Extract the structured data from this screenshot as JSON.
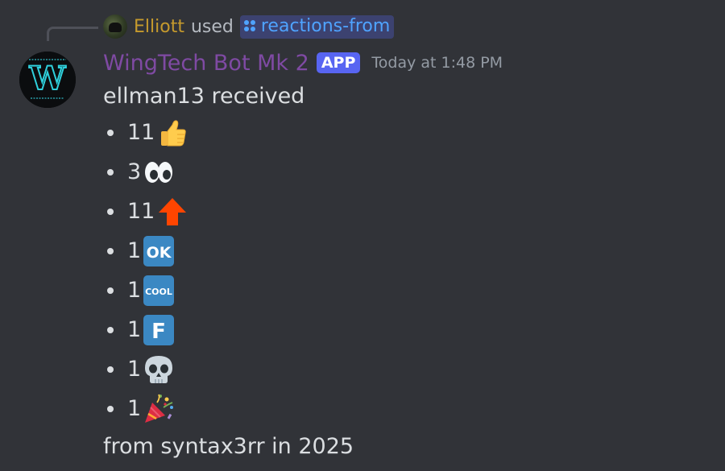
{
  "reply": {
    "username": "Elliott",
    "action": "used",
    "command": "reactions-from",
    "avatar_icon": "avatar-icon"
  },
  "message": {
    "author": "WingTech Bot Mk 2",
    "badge": "APP",
    "timestamp": "Today at 1:48 PM",
    "intro": "ellman13 received",
    "reactions": [
      {
        "count": "11",
        "emoji": "thumbs-up-icon"
      },
      {
        "count": "3",
        "emoji": "eyes-icon"
      },
      {
        "count": "11",
        "emoji": "up-arrow-icon"
      },
      {
        "count": "1",
        "emoji": "ok-icon"
      },
      {
        "count": "1",
        "emoji": "cool-icon"
      },
      {
        "count": "1",
        "emoji": "letter-f-icon"
      },
      {
        "count": "1",
        "emoji": "skull-icon"
      },
      {
        "count": "1",
        "emoji": "party-popper-icon"
      }
    ],
    "outro": "from syntax3rr in 2025"
  },
  "colors": {
    "background": "#313338",
    "reply_username": "#c59a2d",
    "command": "#4fa3ff",
    "author": "#7f4aa3",
    "app_badge": "#5865f2",
    "timestamp": "#949ba4",
    "text": "#dbdee1"
  }
}
